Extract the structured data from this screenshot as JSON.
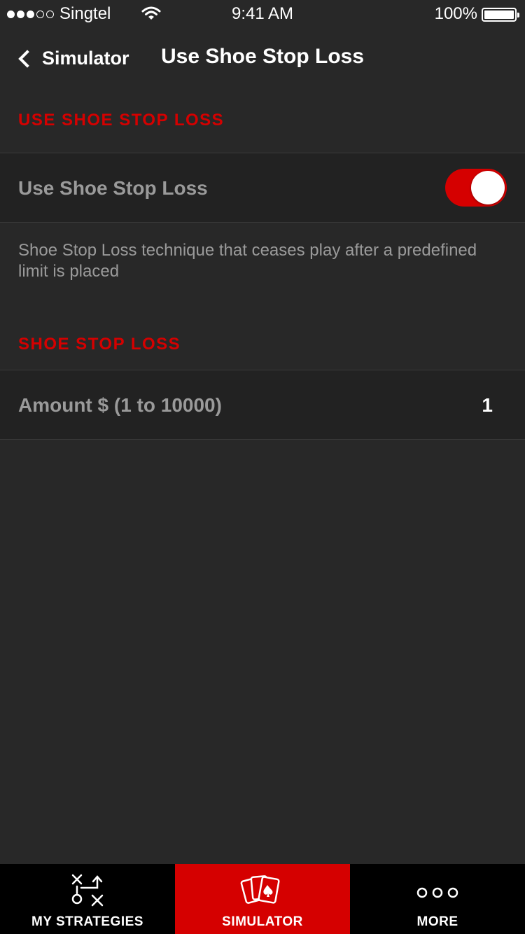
{
  "status_bar": {
    "carrier": "Singtel",
    "time": "9:41 AM",
    "battery": "100%"
  },
  "nav": {
    "back_label": "Simulator",
    "title": "Use Shoe Stop Loss"
  },
  "section1": {
    "header": "USE SHOE STOP LOSS",
    "toggle_label": "Use Shoe Stop Loss",
    "toggle_on": true,
    "description": "Shoe Stop Loss technique that ceases play after a predefined limit is placed"
  },
  "section2": {
    "header": "SHOE STOP LOSS",
    "amount_label": "Amount $ (1 to 10000)",
    "amount_value": "1"
  },
  "tabs": [
    {
      "label": "MY STRATEGIES",
      "icon": "strategy-icon",
      "active": false
    },
    {
      "label": "SIMULATOR",
      "icon": "cards-icon",
      "active": true
    },
    {
      "label": "MORE",
      "icon": "more-icon",
      "active": false
    }
  ],
  "colors": {
    "accent": "#d50000",
    "background": "#282828",
    "cell": "#222222",
    "tab_bar": "#000000"
  }
}
